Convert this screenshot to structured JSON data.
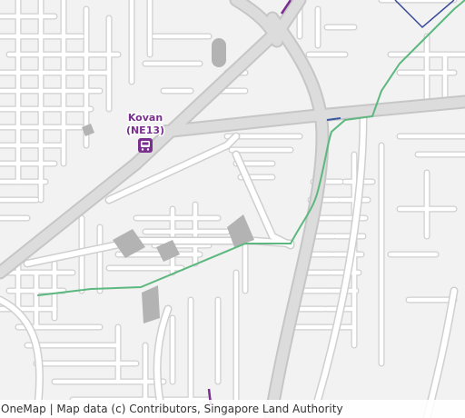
{
  "map": {
    "station": {
      "name": "Kovan",
      "code": "(NE13)",
      "label_color": "#7a2e8e",
      "icon": "mrt-train-icon"
    },
    "park_connector_color": "#5cb87f",
    "mrt_line_color": "#7a2e8e",
    "building_color": "#b3b3b3",
    "road_fill": "#ffffff",
    "road_casing": "#cfcfcf",
    "major_road_fill": "#dcdcdc",
    "attribution": "OneMap | Map data (c) Contributors, Singapore Land Authority"
  }
}
